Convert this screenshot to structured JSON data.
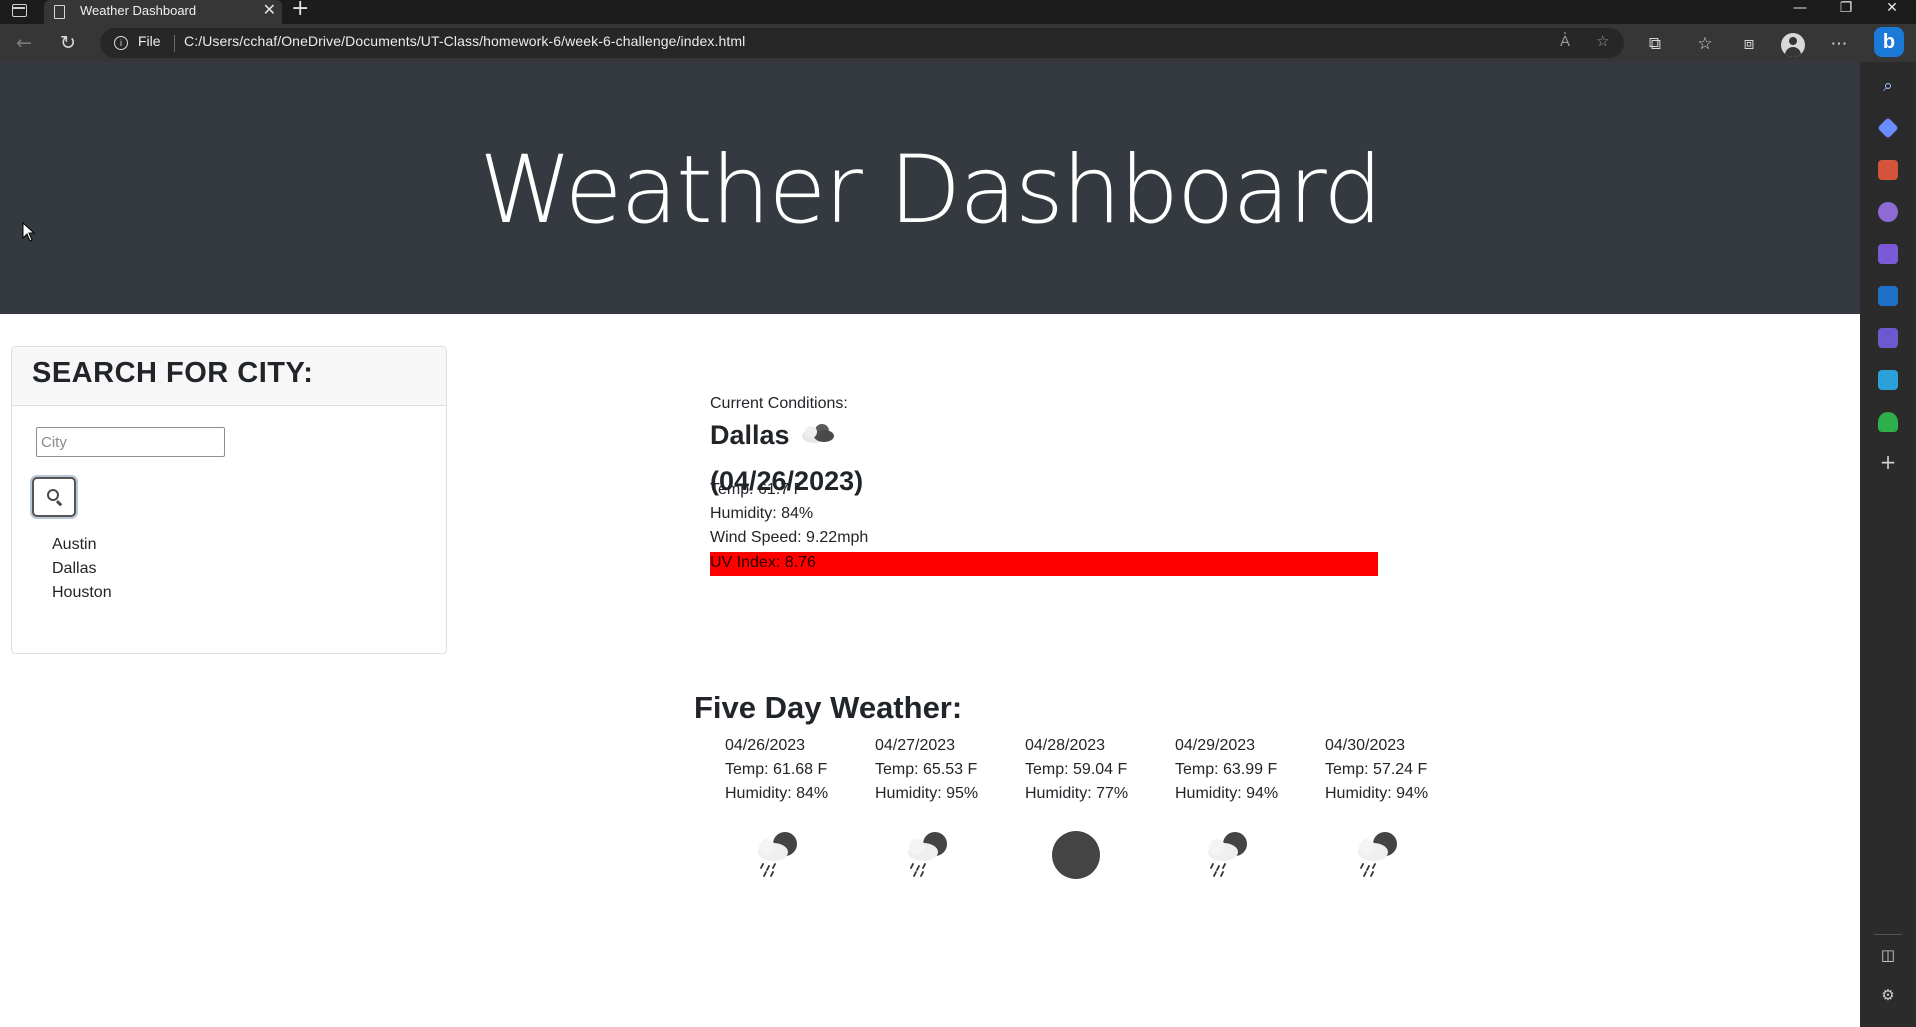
{
  "browser": {
    "tab_title": "Weather Dashboard",
    "tab_close": "✕",
    "new_tab": "+",
    "site_label": "File",
    "url": "C:/Users/cchaf/OneDrive/Documents/UT-Class/homework-6/week-6-challenge/index.html",
    "bing_label": "b",
    "controls": {
      "minimize": "—",
      "restore": "❐",
      "close": "✕"
    }
  },
  "page": {
    "title": "Weather Dashboard"
  },
  "search": {
    "header": "SEARCH FOR CITY:",
    "input_placeholder": "City",
    "input_value": "",
    "button_icon": "search-icon",
    "history": [
      "Austin",
      "Dallas",
      "Houston"
    ]
  },
  "current": {
    "label": "Current Conditions:",
    "city": "Dallas",
    "icon": "cloud-icon",
    "date": "(04/26/2023)",
    "temp": "Temp: 61.7 F",
    "humidity": "Humidity: 84%",
    "wind": "Wind Speed: 9.22mph",
    "uv": "UV Index: 8.76",
    "uv_color": "#ff0000"
  },
  "forecast": {
    "title": "Five Day Weather:",
    "days": [
      {
        "date": "04/26/2023",
        "temp": "Temp: 61.68 F",
        "humidity": "Humidity: 84%",
        "icon": "rain-night-icon"
      },
      {
        "date": "04/27/2023",
        "temp": "Temp: 65.53 F",
        "humidity": "Humidity: 95%",
        "icon": "rain-night-icon"
      },
      {
        "date": "04/28/2023",
        "temp": "Temp: 59.04 F",
        "humidity": "Humidity: 77%",
        "icon": "clear-night-icon"
      },
      {
        "date": "04/29/2023",
        "temp": "Temp: 63.99 F",
        "humidity": "Humidity: 94%",
        "icon": "rain-night-icon"
      },
      {
        "date": "04/30/2023",
        "temp": "Temp: 57.24 F",
        "humidity": "Humidity: 94%",
        "icon": "rain-night-icon"
      }
    ]
  },
  "colors": {
    "jumbotron": "#343a40",
    "uv_high": "#ff0000",
    "chrome_dark": "#1c1c1c",
    "accent": "#1b7ad8"
  }
}
